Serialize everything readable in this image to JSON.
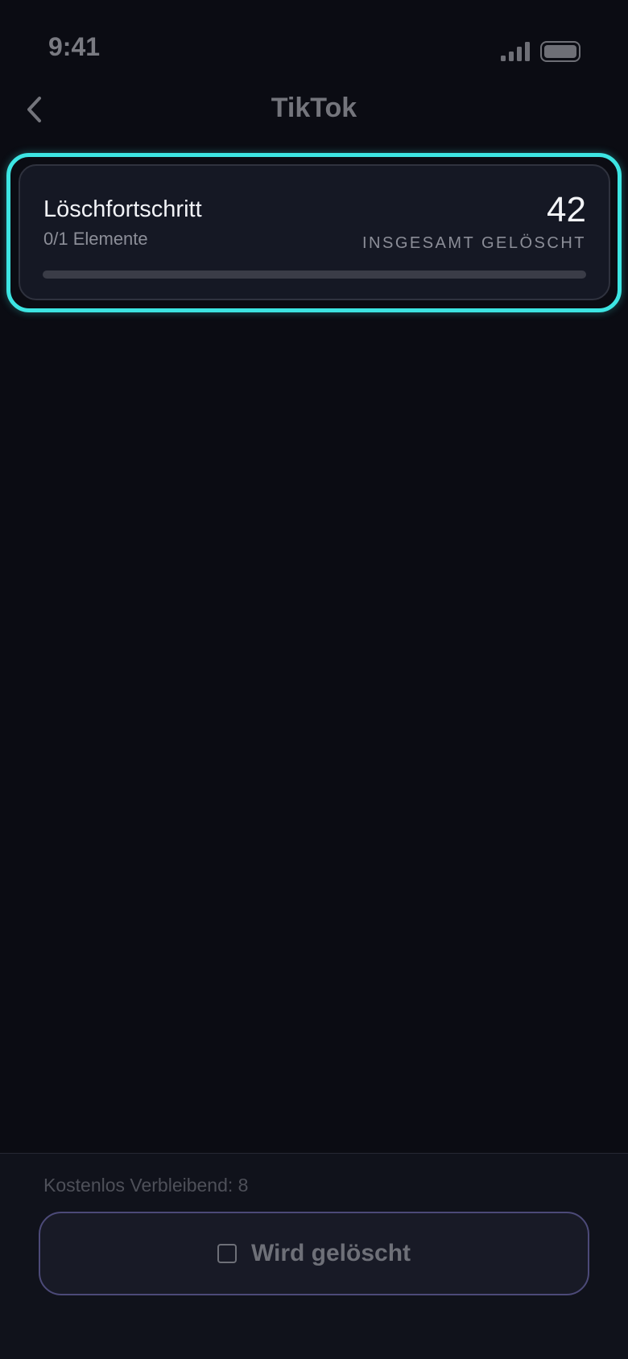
{
  "status_bar": {
    "time": "9:41"
  },
  "header": {
    "title": "TikTok",
    "back_icon": "chevron-left-icon"
  },
  "progress_card": {
    "title": "Löschfortschritt",
    "items_text": "0/1 Elemente",
    "total_deleted": "42",
    "total_deleted_label": "INSGESAMT GELÖSCHT",
    "progress_fraction": 0,
    "accent_color": "#3de5e3"
  },
  "footer": {
    "free_remaining": "Kostenlos Verbleibend: 8",
    "delete_button_label": "Wird gelöscht",
    "delete_button_icon": "stop-icon"
  }
}
